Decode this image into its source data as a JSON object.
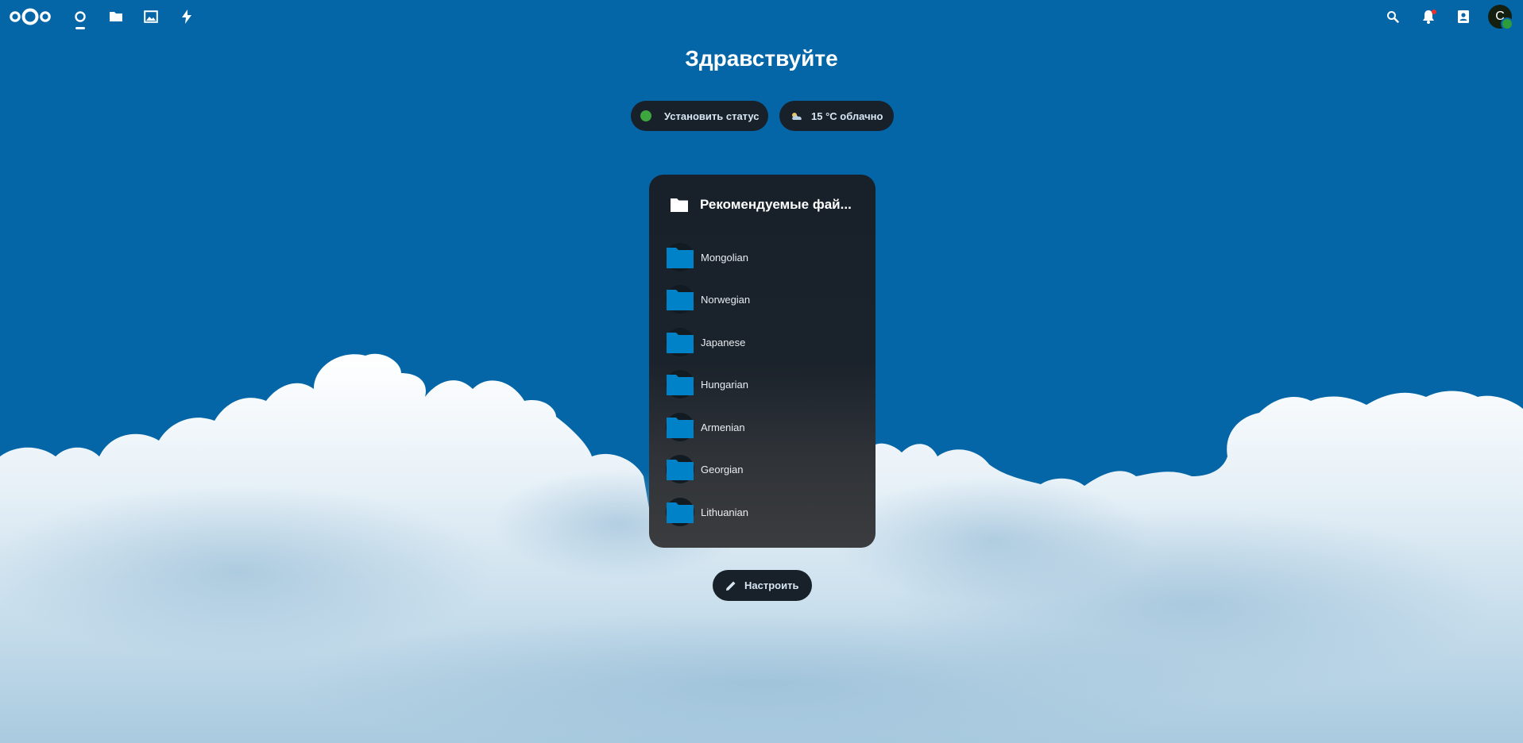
{
  "greeting": "Здравствуйте",
  "status_button": {
    "label": "Установить статус",
    "status_color": "#3ea63e"
  },
  "weather": {
    "label": "15 °C облачно",
    "icon": "cloud-sun-icon"
  },
  "widget": {
    "title": "Рекомендуемые фай...",
    "icon": "folder-icon",
    "files": [
      {
        "name": "Mongolian",
        "icon": "folder-icon"
      },
      {
        "name": "Norwegian",
        "icon": "folder-icon"
      },
      {
        "name": "Japanese",
        "icon": "folder-icon"
      },
      {
        "name": "Hungarian",
        "icon": "folder-icon"
      },
      {
        "name": "Armenian",
        "icon": "folder-icon"
      },
      {
        "name": "Georgian",
        "icon": "folder-icon"
      },
      {
        "name": "Lithuanian",
        "icon": "folder-icon"
      }
    ]
  },
  "customize_button": {
    "label": "Настроить",
    "icon": "pencil-icon"
  },
  "header": {
    "logo": "nextcloud-logo",
    "apps": [
      {
        "name": "dashboard",
        "icon": "dashboard-icon",
        "active": true
      },
      {
        "name": "files",
        "icon": "folder-icon",
        "active": false
      },
      {
        "name": "photos",
        "icon": "image-icon",
        "active": false
      },
      {
        "name": "activity",
        "icon": "lightning-icon",
        "active": false
      }
    ],
    "right_icons": [
      "search-icon",
      "bell-icon",
      "contacts-icon"
    ],
    "avatar_initial": "C"
  },
  "colors": {
    "background": "#0466a6",
    "panel": "#182029",
    "folder": "#0082c9",
    "status_online": "#3ea63e"
  }
}
